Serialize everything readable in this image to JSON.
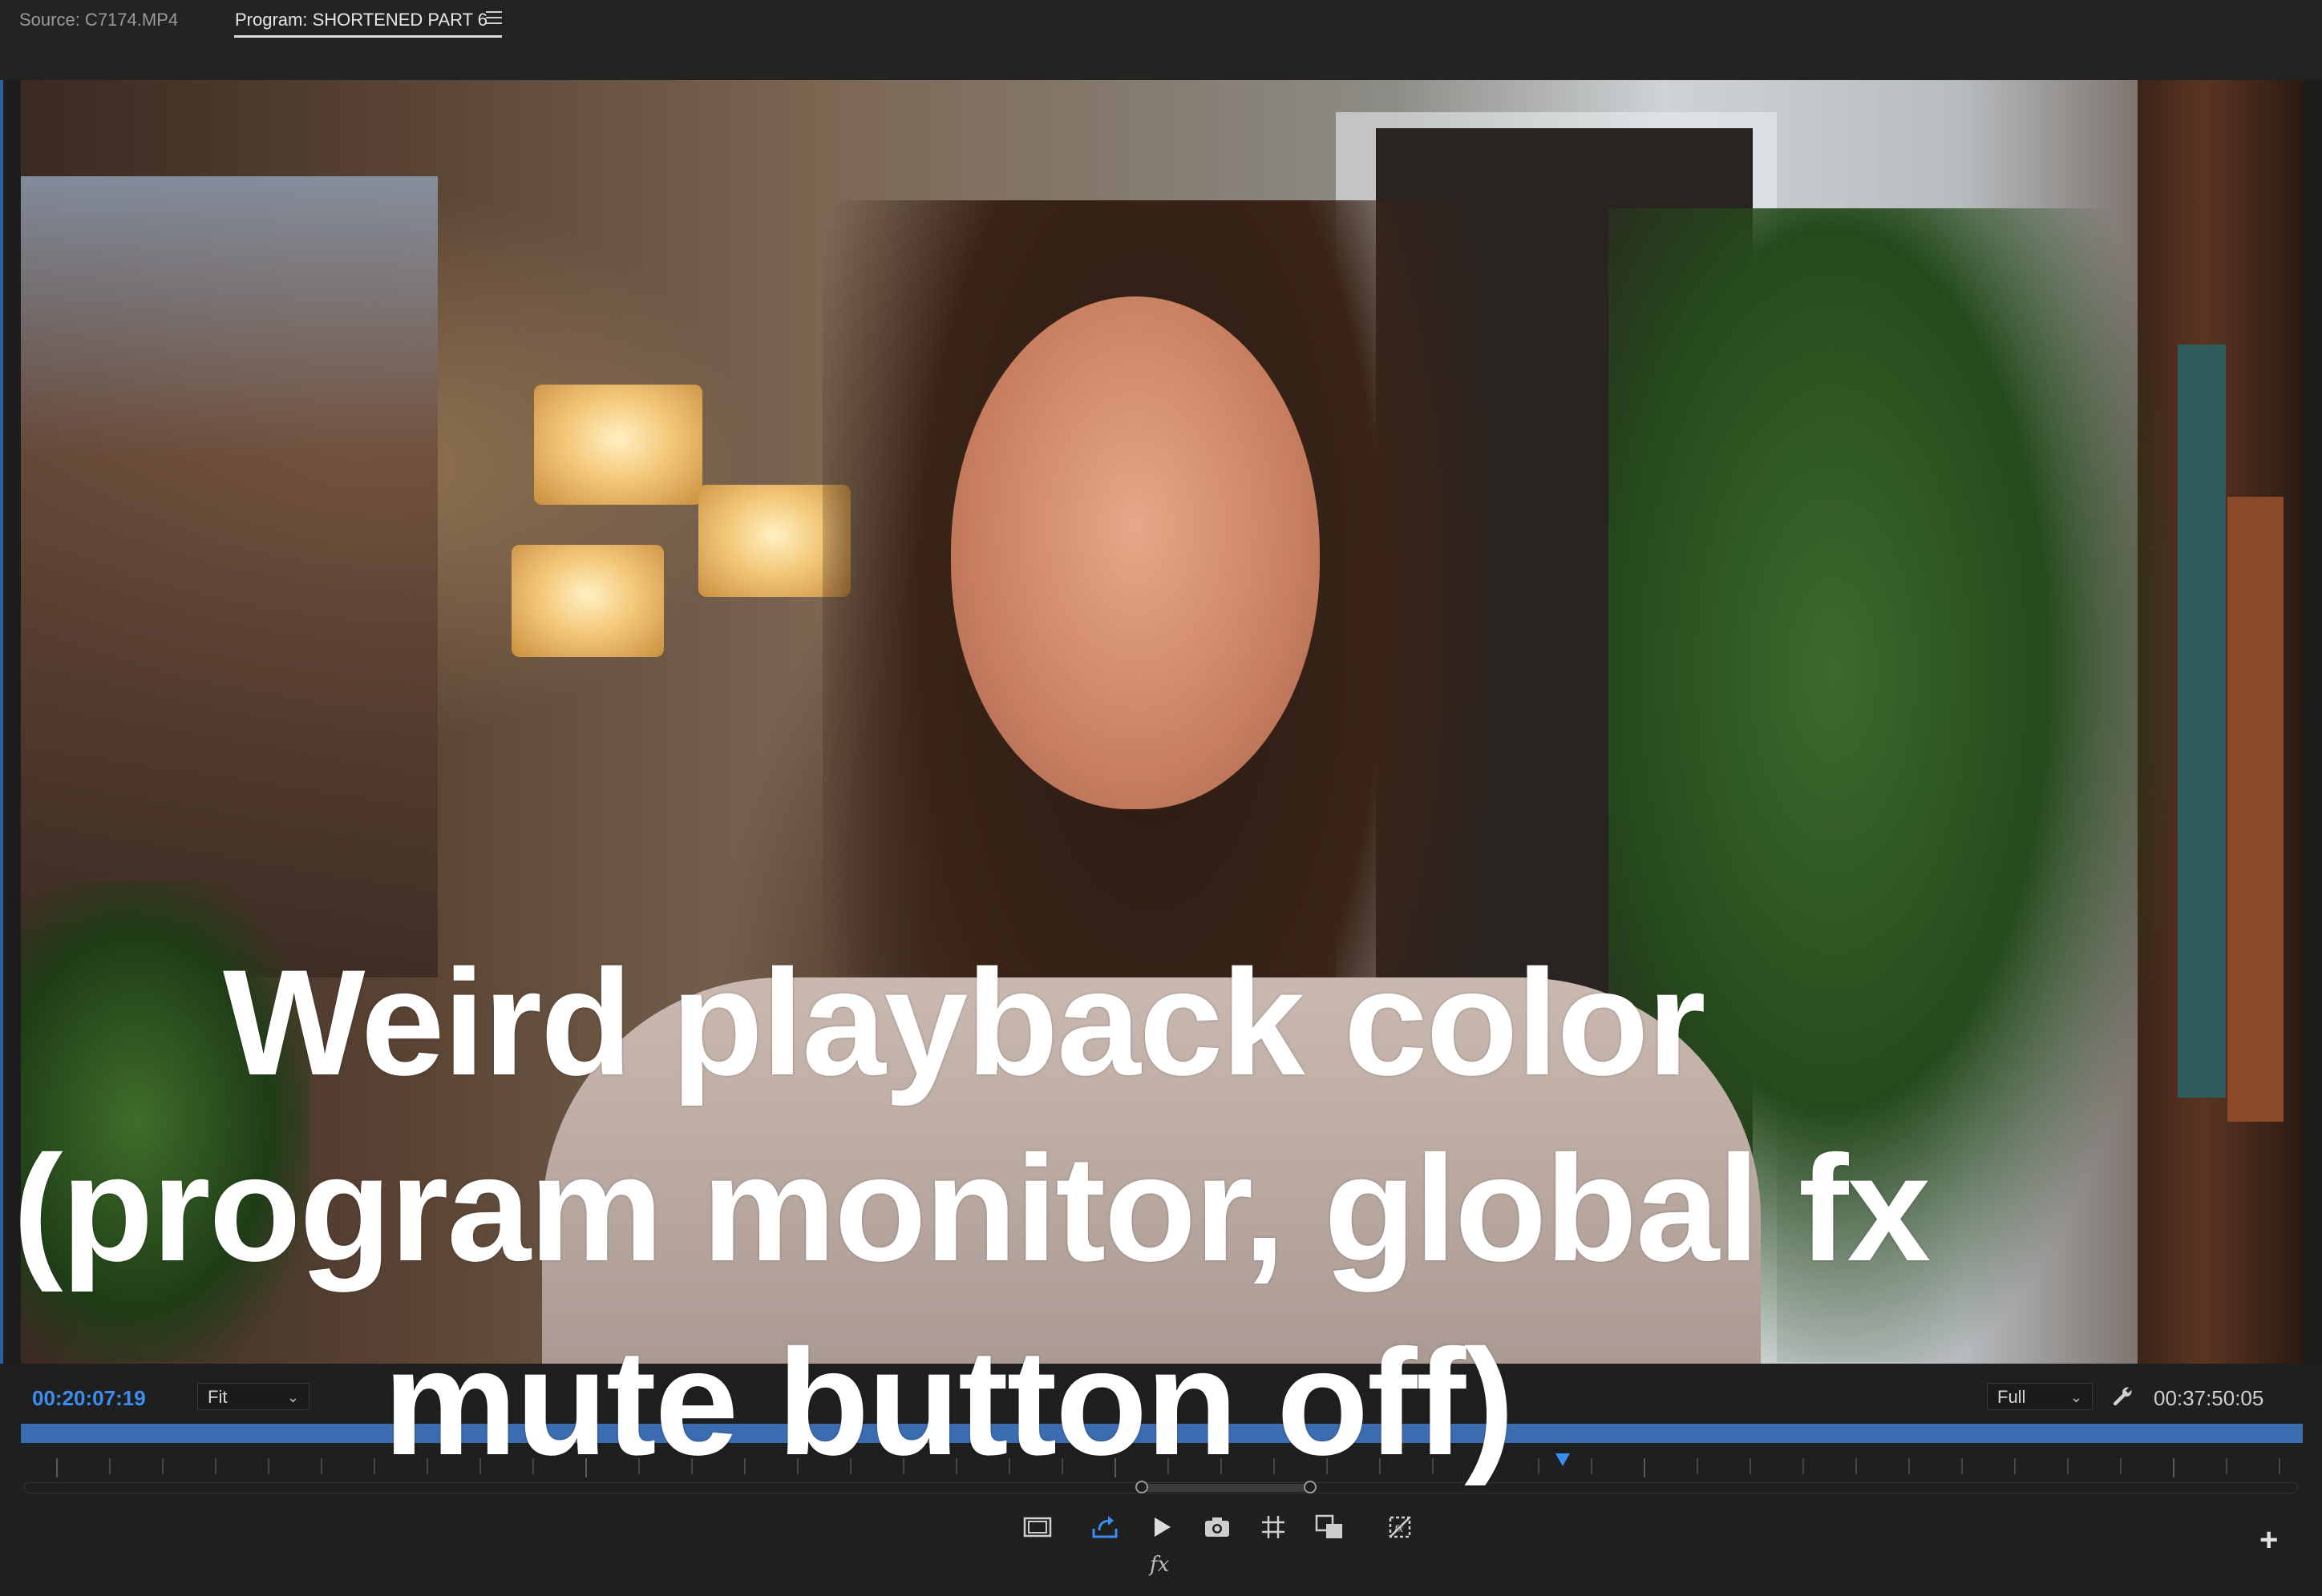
{
  "tabs": {
    "source": "Source: C7174.MP4",
    "program": "Program: SHORTENED PART 6"
  },
  "overlay": {
    "line1": "Weird playback color",
    "line2": "(program monitor, global fx",
    "line3": "mute button off)"
  },
  "controls": {
    "current_timecode": "00:20:07:19",
    "duration_timecode": "00:37:50:05",
    "zoom_select": "Fit",
    "resolution_select": "Full",
    "fx_label": "fx",
    "add_button": "+"
  },
  "icons": {
    "panel_menu": "hamburger-icon",
    "settings": "wrench-icon",
    "safe_margins": "safe-margins-icon",
    "export_frame_alt": "lift-extract-icon",
    "play": "play-icon",
    "camera": "camera-icon",
    "grid": "grid-icon",
    "comparison": "comparison-view-icon",
    "global_fx_mute": "global-fx-mute-icon",
    "add": "plus-icon"
  },
  "colors": {
    "accent": "#3b8df0",
    "scrub_bar": "#3c6cb0",
    "panel_bg": "#1f1f1f",
    "overlay_text": "#ffffff"
  }
}
